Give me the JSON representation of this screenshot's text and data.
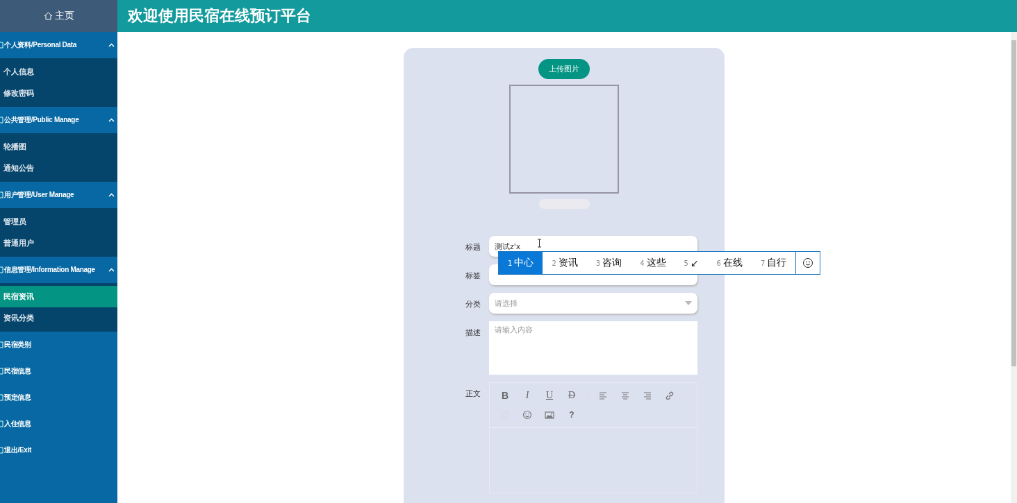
{
  "header": {
    "title": "欢迎使用民宿在线预订平台"
  },
  "sidebar": {
    "home": {
      "label": "主页"
    },
    "groups": [
      {
        "label": "个人资料/Personal Data",
        "expanded": true,
        "children": [
          {
            "label": "个人信息",
            "selected": false
          },
          {
            "label": "修改密码",
            "selected": false
          }
        ]
      },
      {
        "label": "公共管理/Public Manage",
        "expanded": true,
        "children": [
          {
            "label": "轮播图",
            "selected": false
          },
          {
            "label": "通知公告",
            "selected": false
          }
        ]
      },
      {
        "label": "用户管理/User Manage",
        "expanded": true,
        "children": [
          {
            "label": "管理员",
            "selected": false
          },
          {
            "label": "普通用户",
            "selected": false
          }
        ]
      },
      {
        "label": "信息管理/Information Manage",
        "expanded": true,
        "children": [
          {
            "label": "民宿资讯",
            "selected": true
          },
          {
            "label": "资讯分类",
            "selected": false
          }
        ]
      },
      {
        "label": "民宿类别"
      },
      {
        "label": "民宿信息"
      },
      {
        "label": "预定信息"
      },
      {
        "label": "入住信息"
      },
      {
        "label": "退出/Exit"
      }
    ]
  },
  "form": {
    "upload_button": "上传图片",
    "fields": [
      {
        "kind": "input",
        "label": "标题",
        "value": "测试z'x"
      },
      {
        "kind": "input",
        "label": "标签"
      },
      {
        "kind": "select",
        "label": "分类",
        "placeholder": "请选择"
      },
      {
        "kind": "textarea",
        "label": "描述",
        "placeholder": "请输入内容"
      },
      {
        "kind": "editor",
        "label": "正文"
      }
    ],
    "toolbar": [
      {
        "kind": "bold",
        "label": "B",
        "disabled": false
      },
      {
        "kind": "italic",
        "label": "I",
        "disabled": false
      },
      {
        "kind": "underline",
        "label": "U",
        "disabled": false
      },
      {
        "kind": "strike",
        "label": "D",
        "disabled": false
      },
      {
        "kind": "align-left",
        "disabled": false
      },
      {
        "kind": "align-center",
        "disabled": false
      },
      {
        "kind": "align-right",
        "disabled": false
      },
      {
        "kind": "link",
        "disabled": false
      },
      {
        "kind": "unlink",
        "disabled": true
      },
      {
        "kind": "emoji",
        "disabled": false
      },
      {
        "kind": "image",
        "disabled": false
      },
      {
        "kind": "help",
        "label": "?",
        "disabled": false
      }
    ]
  },
  "ime": {
    "candidates": [
      {
        "index": "1",
        "text": "中心",
        "selected": true
      },
      {
        "index": "2",
        "text": "资讯",
        "selected": false
      },
      {
        "index": "3",
        "text": "咨询",
        "selected": false
      },
      {
        "index": "4",
        "text": "这些",
        "selected": false
      },
      {
        "index": "5",
        "text": "↙",
        "selected": false
      },
      {
        "index": "6",
        "text": "在线",
        "selected": false
      },
      {
        "index": "7",
        "text": "自行",
        "selected": false
      }
    ]
  }
}
